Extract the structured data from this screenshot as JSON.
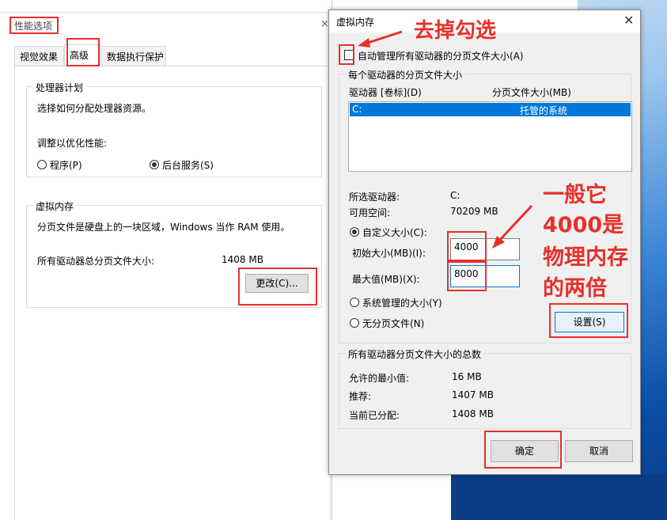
{
  "perf_window": {
    "title": "性能选项",
    "close_glyph": "×",
    "tabs": [
      {
        "label": "视觉效果"
      },
      {
        "label": "高级"
      },
      {
        "label": "数据执行保护"
      }
    ],
    "processor_group": {
      "legend": "处理器计划",
      "description": "选择如何分配处理器资源。",
      "optimize_label": "调整以优化性能:",
      "option_programs": "程序(P)",
      "option_services": "后台服务(S)"
    },
    "vm_group": {
      "legend": "虚拟内存",
      "description": "分页文件是硬盘上的一块区域，Windows 当作 RAM 使用。",
      "total_label": "所有驱动器总分页文件大小:",
      "total_value": "1408 MB",
      "change_button": "更改(C)..."
    }
  },
  "vm_dialog": {
    "title": "虚拟内存",
    "close_glyph": "✕",
    "auto_manage_label": "自动管理所有驱动器的分页文件大小(A)",
    "per_drive_legend": "每个驱动器的分页文件大小",
    "col_drive": "驱动器 [卷标](D)",
    "col_size": "分页文件大小(MB)",
    "drives": [
      {
        "drive": "C:",
        "size": "托管的系统"
      }
    ],
    "selected_drive_label": "所选驱动器:",
    "selected_drive_value": "C:",
    "free_space_label": "可用空间:",
    "free_space_value": "70209 MB",
    "custom_size_label": "自定义大小(C):",
    "initial_size_label": "初始大小(MB)(I):",
    "initial_size_value": "4000",
    "max_size_label": "最大值(MB)(X):",
    "max_size_value": "8000",
    "system_managed_label": "系统管理的大小(Y)",
    "no_paging_label": "无分页文件(N)",
    "set_button": "设置(S)",
    "totals_legend": "所有驱动器分页文件大小的总数",
    "min_allowed_label": "允许的最小值:",
    "min_allowed_value": "16 MB",
    "recommended_label": "推荐:",
    "recommended_value": "1407 MB",
    "allocated_label": "当前已分配:",
    "allocated_value": "1408 MB",
    "ok_button": "确定",
    "cancel_button": "取消"
  },
  "annotations": {
    "uncheck_note": "去掉勾选",
    "note_line1": "一般它",
    "note_line2": "4000是",
    "note_line3": "物理内存",
    "note_line4": "的两倍"
  },
  "colors": {
    "annotation_red": "#e8302a",
    "selection_blue": "#0078d7"
  }
}
